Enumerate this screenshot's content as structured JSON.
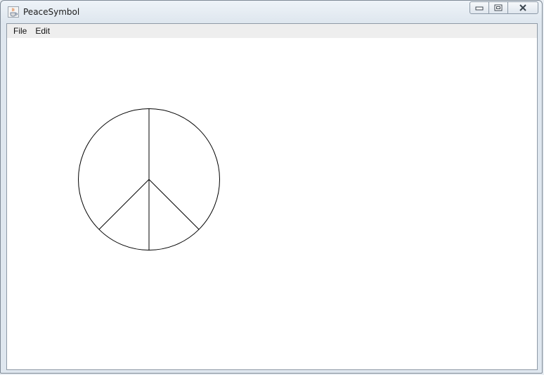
{
  "window": {
    "title": "PeaceSymbol",
    "app_icon": "java-cup-icon",
    "controls": {
      "minimize_icon": "minimize-icon",
      "maximize_icon": "maximize-icon",
      "close_icon": "close-icon"
    }
  },
  "menubar": {
    "items": [
      {
        "label": "File"
      },
      {
        "label": "Edit"
      }
    ]
  },
  "canvas": {
    "drawing": "peace-symbol",
    "stroke_color": "#000000",
    "background_color": "#ffffff"
  }
}
